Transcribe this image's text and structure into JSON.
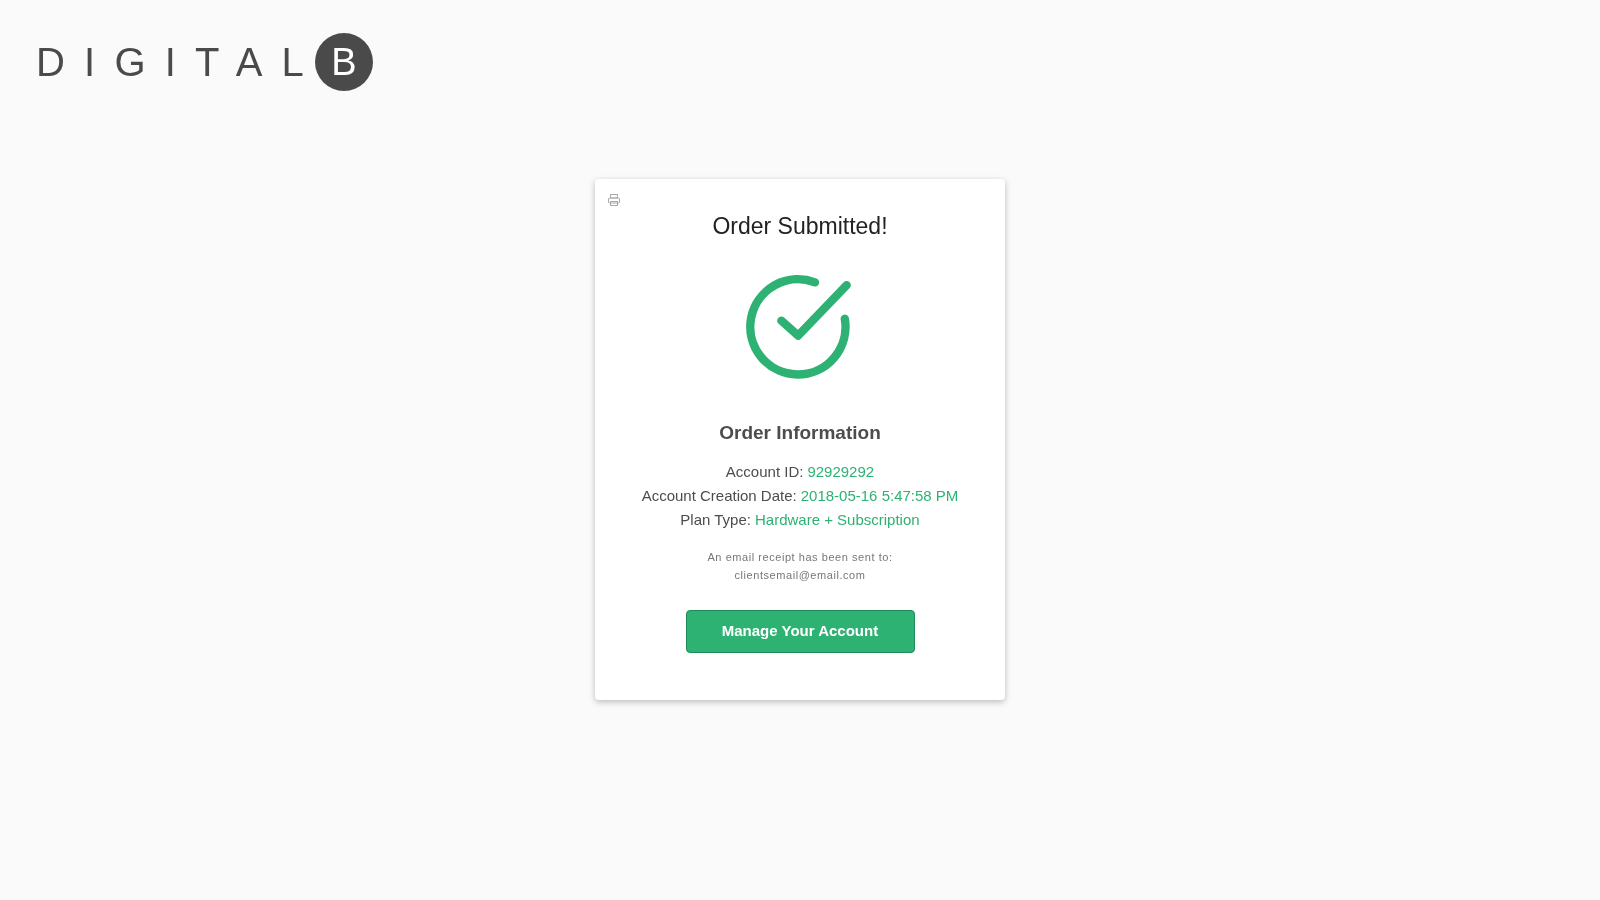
{
  "logo": {
    "text": "DIGITAL",
    "badge": "B"
  },
  "card": {
    "title": "Order Submitted!",
    "section_title": "Order Information",
    "details": [
      {
        "label": "Account ID:",
        "value": "92929292"
      },
      {
        "label": "Account Creation Date:",
        "value": "2018-05-16 5:47:58 PM"
      },
      {
        "label": "Plan Type:",
        "value": "Hardware + Subscription"
      }
    ],
    "receipt_note": "An email receipt has been sent to:",
    "email": "clientsemail@email.com",
    "button": "Manage Your Account"
  }
}
